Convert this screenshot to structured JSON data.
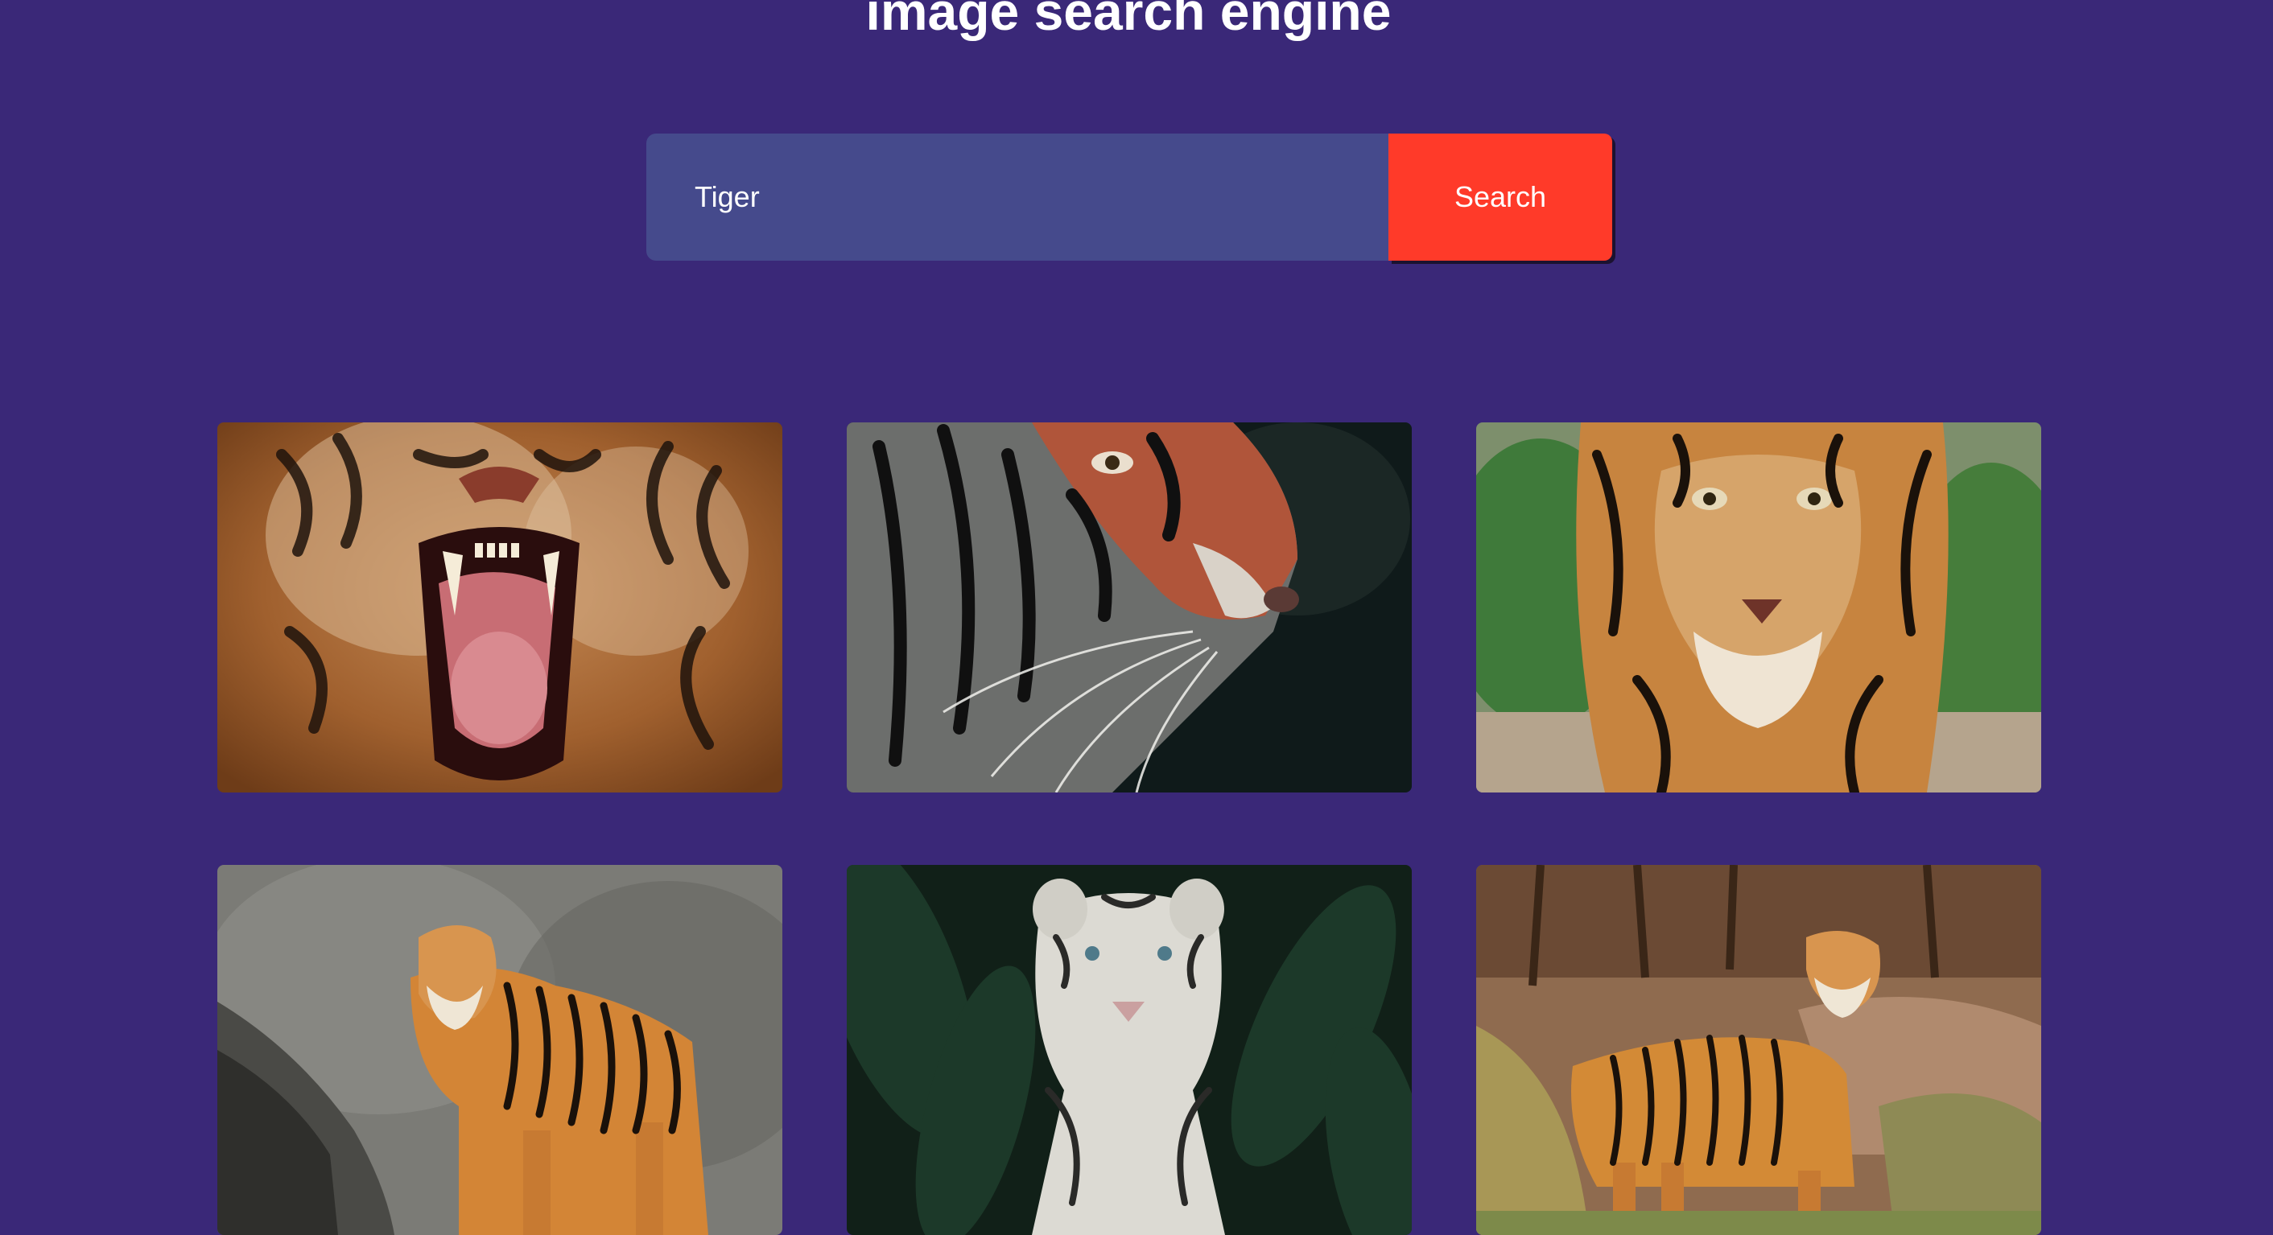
{
  "header": {
    "title": "image search engine"
  },
  "search": {
    "value": "Tiger",
    "button_label": "Search"
  },
  "results": [
    {
      "subject": "roaring tiger"
    },
    {
      "subject": "tiger face profile"
    },
    {
      "subject": "tiger face forward"
    },
    {
      "subject": "bengal tiger standing on rock"
    },
    {
      "subject": "white tiger in jungle"
    },
    {
      "subject": "tiger standing on grassy rocks"
    }
  ],
  "colors": {
    "background": "#3a2878",
    "input_background": "#454a8c",
    "button": "#ff3a29",
    "text": "#ffffff"
  }
}
